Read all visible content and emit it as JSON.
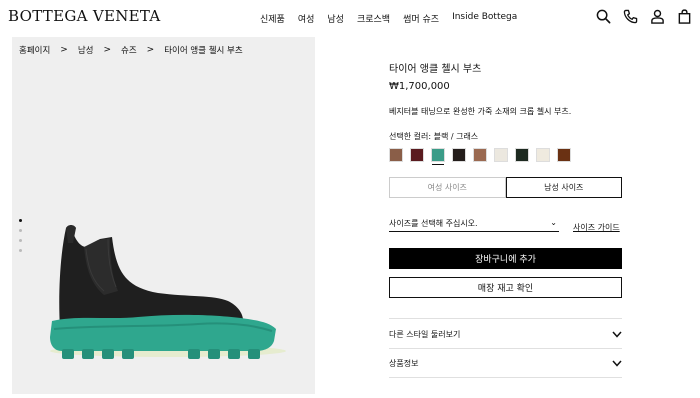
{
  "header": {
    "logo": "BOTTEGA VENETA",
    "nav": [
      "신제품",
      "여성",
      "남성",
      "크로스백",
      "썸머 슈즈",
      "Inside Bottega"
    ],
    "icons": [
      "search-icon",
      "phone-icon",
      "account-icon",
      "bag-icon"
    ]
  },
  "breadcrumb": [
    "홈페이지",
    "남성",
    "슈즈",
    "타이어 앵클 첼시 부츠"
  ],
  "gallery": {
    "image_count": 4,
    "active_index": 0
  },
  "product": {
    "title": "타이어 앵클 첼시 부츠",
    "price": "₩1,700,000",
    "description": "베지터블 태닝으로 완성한 가죽 소재의 크롭 첼시 부츠.",
    "color_label": "선택한 컬러: 블랙 / 그래스",
    "swatches": [
      "#8a5e48",
      "#5a1b1f",
      "#3b9c88",
      "#241d1b",
      "#9b6a51",
      "#ece8df",
      "#1d2a20",
      "#efeadf",
      "#6a3113"
    ],
    "selected_swatch": 2
  },
  "sizes": {
    "tabs": [
      "여성 사이즈",
      "남성 사이즈"
    ],
    "active_tab": 1,
    "select_placeholder": "사이즈를 선택해 주십시오.",
    "guide_link": "사이즈 가이드"
  },
  "actions": {
    "add_to_cart": "장바구니에 추가",
    "store_stock": "매장 재고 확인"
  },
  "accordions": [
    "다른 스타일 둘러보기",
    "상품정보"
  ],
  "colors": {
    "accent": "#000000",
    "sole_green": "#2fa78e",
    "image_bg": "#efefef"
  }
}
